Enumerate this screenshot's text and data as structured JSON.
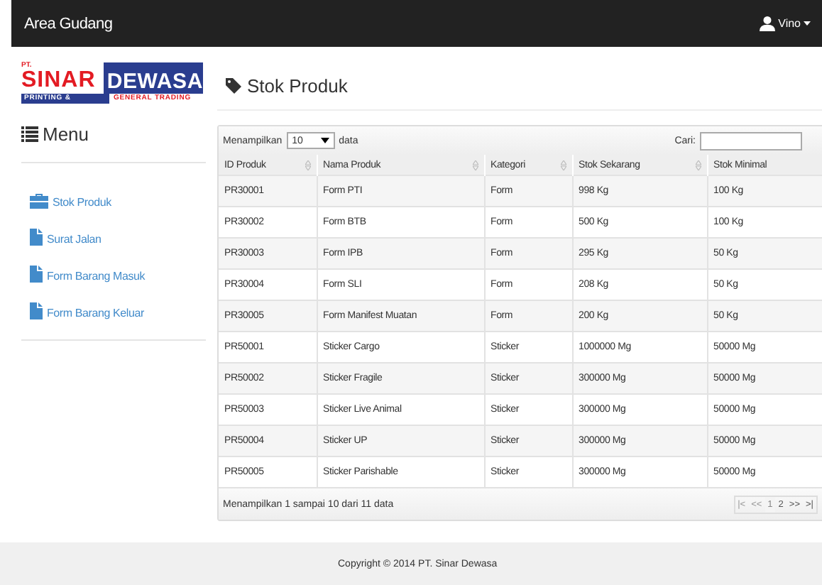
{
  "navbar": {
    "brand": "Area Gudang",
    "user": "Vino"
  },
  "logo": {
    "prefix": "PT.",
    "word_1": "SINAR",
    "word_2": "DEWASA",
    "tagline_1": "PRINTING &",
    "tagline_2": "GENERAL TRADING"
  },
  "sidebar": {
    "title": "Menu",
    "items": [
      {
        "label": "Stok Produk",
        "kind": "briefcase"
      },
      {
        "label": "Surat Jalan",
        "kind": "file"
      },
      {
        "label": "Form Barang Masuk",
        "kind": "file"
      },
      {
        "label": "Form Barang Keluar",
        "kind": "file"
      }
    ]
  },
  "page_title": "Stok Produk",
  "table": {
    "length_label": "Menampilkan",
    "length_value": "10",
    "length_suffix": "data",
    "search_label": "Cari:",
    "columns": [
      "ID Produk",
      "Nama Produk",
      "Kategori",
      "Stok Sekarang",
      "Stok Minimal"
    ],
    "rows": [
      [
        "PR30001",
        "Form PTI",
        "Form",
        "998 Kg",
        "100 Kg"
      ],
      [
        "PR30002",
        "Form BTB",
        "Form",
        "500 Kg",
        "100 Kg"
      ],
      [
        "PR30003",
        "Form IPB",
        "Form",
        "295 Kg",
        "50 Kg"
      ],
      [
        "PR30004",
        "Form SLI",
        "Form",
        "208 Kg",
        "50 Kg"
      ],
      [
        "PR30005",
        "Form Manifest Muatan",
        "Form",
        "200 Kg",
        "50 Kg"
      ],
      [
        "PR50001",
        "Sticker Cargo",
        "Sticker",
        "1000000 Mg",
        "50000 Mg"
      ],
      [
        "PR50002",
        "Sticker Fragile",
        "Sticker",
        "300000 Mg",
        "50000 Mg"
      ],
      [
        "PR50003",
        "Sticker Live Animal",
        "Sticker",
        "300000 Mg",
        "50000 Mg"
      ],
      [
        "PR50004",
        "Sticker UP",
        "Sticker",
        "300000 Mg",
        "50000 Mg"
      ],
      [
        "PR50005",
        "Sticker Parishable",
        "Sticker",
        "300000 Mg",
        "50000 Mg"
      ]
    ],
    "info": "Menampilkan 1 sampai 10 dari 11 data",
    "pagination": [
      {
        "label": "|<",
        "selected": false,
        "disabled": true
      },
      {
        "label": "<<",
        "selected": false,
        "disabled": true
      },
      {
        "label": "1",
        "selected": true,
        "disabled": false
      },
      {
        "label": "2",
        "selected": false,
        "disabled": false
      },
      {
        "label": ">>",
        "selected": false,
        "disabled": false
      },
      {
        "label": ">|",
        "selected": false,
        "disabled": false
      }
    ]
  },
  "footer": "Copyright © 2014 PT. Sinar Dewasa"
}
